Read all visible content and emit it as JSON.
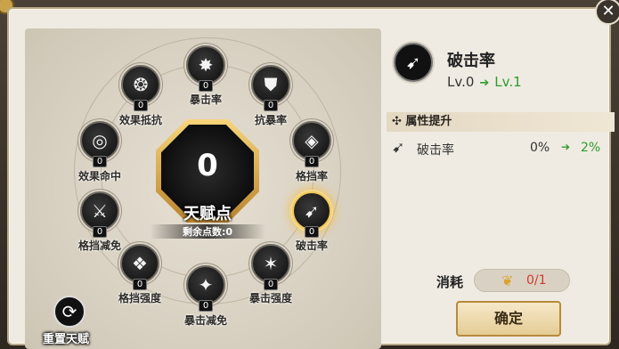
{
  "nodes": [
    {
      "key": "crit_rate_top",
      "label": "暴击率",
      "level": "0",
      "icon": "swords-burst-icon",
      "glyph": "✸"
    },
    {
      "key": "crit_resist",
      "label": "抗暴率",
      "level": "0",
      "icon": "shield-bolt-icon",
      "glyph": "⛊"
    },
    {
      "key": "block_rate",
      "label": "格挡率",
      "level": "0",
      "icon": "shield-icon",
      "glyph": "◈"
    },
    {
      "key": "pierce_rate",
      "label": "破击率",
      "level": "0",
      "icon": "pierce-icon",
      "glyph": "➹"
    },
    {
      "key": "crit_strength",
      "label": "暴击强度",
      "level": "0",
      "icon": "star-burst-icon",
      "glyph": "✶"
    },
    {
      "key": "crit_reduce",
      "label": "暴击减免",
      "level": "0",
      "icon": "shield-spark-icon",
      "glyph": "✦"
    },
    {
      "key": "block_strength",
      "label": "格挡强度",
      "level": "0",
      "icon": "wing-shield-icon",
      "glyph": "❖"
    },
    {
      "key": "block_reduce",
      "label": "格挡减免",
      "level": "0",
      "icon": "shield-slash-icon",
      "glyph": "⚔"
    },
    {
      "key": "effect_hit",
      "label": "效果命中",
      "level": "0",
      "icon": "target-icon",
      "glyph": "◎"
    },
    {
      "key": "effect_resist",
      "label": "效果抵抗",
      "level": "0",
      "icon": "crest-icon",
      "glyph": "❂"
    }
  ],
  "center": {
    "value": "0",
    "title": "天赋点",
    "remaining": "剩余点数:0"
  },
  "reset": {
    "label": "重置天赋"
  },
  "detail": {
    "name": "破击率",
    "lv_from": "Lv.0",
    "lv_to": "Lv.1",
    "section": "属性提升",
    "attr_name": "破击率",
    "attr_from": "0%",
    "attr_to": "2%"
  },
  "cost": {
    "label": "消耗",
    "value": "0/1"
  },
  "confirm": {
    "label": "确定"
  },
  "colors": {
    "accent": "#2d9b2d",
    "cost_red": "#d03a2a",
    "gold": "#f3c75a"
  }
}
